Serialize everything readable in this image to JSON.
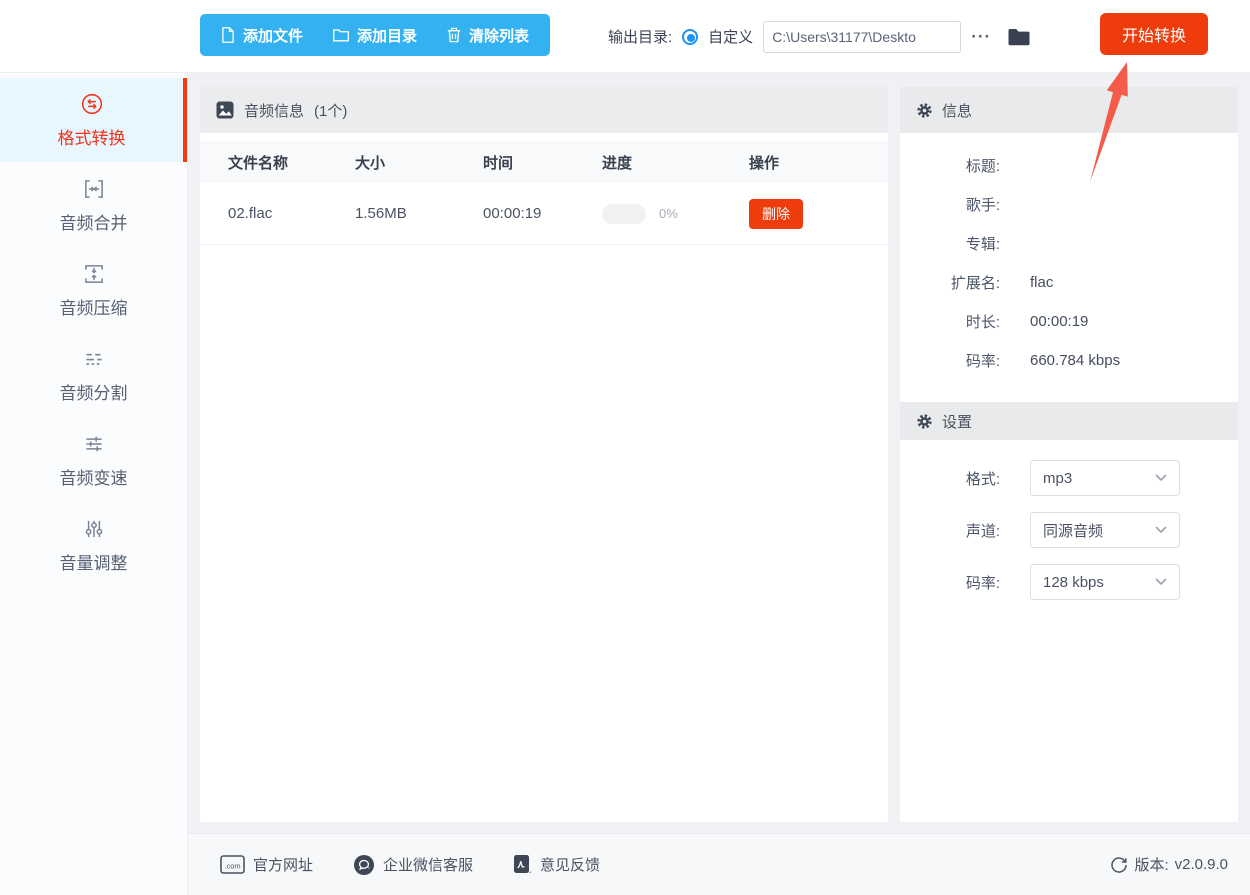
{
  "topbar": {
    "add_file": "添加文件",
    "add_dir": "添加目录",
    "clear_list": "清除列表",
    "output_dir_label": "输出目录:",
    "custom_option": "自定义",
    "path_value": "C:\\Users\\31177\\Deskto",
    "more_button": "···",
    "start_convert": "开始转换"
  },
  "sidebar": {
    "items": [
      {
        "label": "格式转换",
        "icon": "format-convert-icon",
        "active": true
      },
      {
        "label": "音频合并",
        "icon": "audio-merge-icon",
        "active": false
      },
      {
        "label": "音频压缩",
        "icon": "audio-compress-icon",
        "active": false
      },
      {
        "label": "音频分割",
        "icon": "audio-split-icon",
        "active": false
      },
      {
        "label": "音频变速",
        "icon": "audio-speed-icon",
        "active": false
      },
      {
        "label": "音量调整",
        "icon": "volume-adjust-icon",
        "active": false
      }
    ]
  },
  "file_panel": {
    "title": "音频信息",
    "count": "(1个)",
    "columns": [
      "文件名称",
      "大小",
      "时间",
      "进度",
      "操作"
    ],
    "rows": [
      {
        "name": "02.flac",
        "size": "1.56MB",
        "time": "00:00:19",
        "progress_percent": 0,
        "progress_text": "0%",
        "action": "删除"
      }
    ]
  },
  "info_panel": {
    "title": "信息",
    "fields": [
      {
        "label": "标题:",
        "value": ""
      },
      {
        "label": "歌手:",
        "value": ""
      },
      {
        "label": "专辑:",
        "value": ""
      },
      {
        "label": "扩展名:",
        "value": "flac"
      },
      {
        "label": "时长:",
        "value": "00:00:19"
      },
      {
        "label": "码率:",
        "value": "660.784 kbps"
      }
    ]
  },
  "settings_panel": {
    "title": "设置",
    "fields": [
      {
        "label": "格式:",
        "value": "mp3"
      },
      {
        "label": "声道:",
        "value": "同源音频"
      },
      {
        "label": "码率:",
        "value": "128 kbps"
      }
    ]
  },
  "footer": {
    "official_site": "官方网址",
    "wechat_support": "企业微信客服",
    "feedback": "意见反馈",
    "version_label": "版本:",
    "version_value": "v2.0.9.0",
    "com_badge": ".com"
  },
  "colors": {
    "accent_blue": "#33b1f1",
    "accent_red": "#ee3c0c",
    "sidebar_active_red": "#f5321e",
    "arrow_red": "#f55b4b",
    "page_bg": "#f0f1f4"
  }
}
